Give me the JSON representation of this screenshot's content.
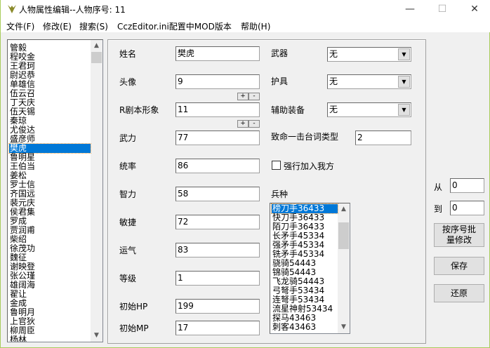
{
  "window": {
    "title": "人物属性编辑--人物序号: 11",
    "minimize": "—",
    "maximize": "☐",
    "close": "✕"
  },
  "menu": [
    "文件(F)",
    "修改(E)",
    "搜索(S)",
    "CczEditor.ini配置中MOD版本",
    "帮助(H)"
  ],
  "characters": [
    "管毅",
    "程咬金",
    "王君珂",
    "尉迟恭",
    "单雄信",
    "伍云召",
    "丁天庆",
    "伍天锡",
    "秦琼",
    "尤俊达",
    "盛彦师",
    "樊虎",
    "鲁明星",
    "王伯当",
    "姜松",
    "罗士信",
    "齐国远",
    "裴元庆",
    "侯君集",
    "罗成",
    "贾润甫",
    "柴绍",
    "徐茂功",
    "魏征",
    "谢映登",
    "张公瑾",
    "雄阔海",
    "翟让",
    "金成",
    "鲁明月",
    "上官狄",
    "柳周臣",
    "杨林"
  ],
  "selected_character_index": 11,
  "fields": [
    {
      "label": "姓名",
      "value": "樊虎"
    },
    {
      "label": "头像",
      "value": "9"
    },
    {
      "label": "R剧本形象",
      "value": "11"
    },
    {
      "label": "武力",
      "value": "77"
    },
    {
      "label": "统率",
      "value": "86"
    },
    {
      "label": "智力",
      "value": "58"
    },
    {
      "label": "敏捷",
      "value": "72"
    },
    {
      "label": "运气",
      "value": "83"
    },
    {
      "label": "等级",
      "value": "1"
    },
    {
      "label": "初始HP",
      "value": "199"
    },
    {
      "label": "初始MP",
      "value": "17"
    }
  ],
  "stepper": {
    "plus": "+",
    "minus": "-"
  },
  "equipment": [
    {
      "label": "武器",
      "value": "无"
    },
    {
      "label": "护具",
      "value": "无"
    },
    {
      "label": "辅助装备",
      "value": "无"
    }
  ],
  "crit_line": {
    "label": "致命一击台词类型",
    "value": "2"
  },
  "force_join": {
    "label": "强行加入我方",
    "checked": false
  },
  "troop_label": "兵种",
  "troops": [
    "榜刀手36433",
    "快刀手36433",
    "陌刀手36433",
    "长矛手45334",
    "强矛手45334",
    "铣矛手45334",
    "骁骑54443",
    "锦骑54443",
    "飞龙骑54443",
    "弓弩手53434",
    "连弩手53434",
    "流星神射53434",
    "探马43463",
    "刺客43463"
  ],
  "selected_troop_index": 0,
  "batch": {
    "from_label": "从",
    "from_value": "0",
    "to_label": "到",
    "to_value": "0",
    "batch_button": "按序号批量修改",
    "save_button": "保存",
    "restore_button": "还原"
  },
  "colors": {
    "selection": "#0078d7"
  }
}
